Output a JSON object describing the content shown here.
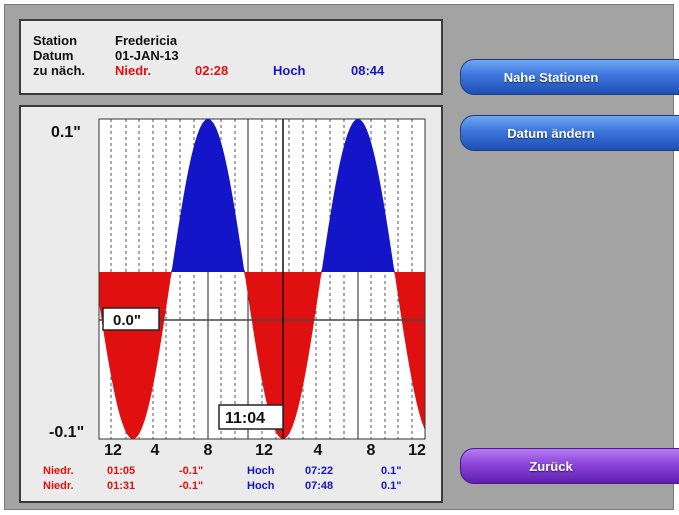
{
  "info": {
    "station_label": "Station",
    "station_value": "Fredericia",
    "datum_label": "Datum",
    "datum_value": "01-JAN-13",
    "next_label": "zu näch.",
    "next_low_label": "Niedr.",
    "next_low_time": "02:28",
    "next_high_label": "Hoch",
    "next_high_time": "08:44"
  },
  "buttons": {
    "nearby_stations": "Nahe Stationen",
    "change_date": "Datum ändern",
    "back": "Zurück"
  },
  "chart": {
    "y_max_label": "0.1\"",
    "y_min_label": "-0.1\"",
    "level_box": "0.0\"",
    "cursor_time": "11:04",
    "x_tick_labels": [
      "12",
      "4",
      "8",
      "12",
      "4",
      "8",
      "12"
    ]
  },
  "tide_table": [
    {
      "low_label": "Niedr.",
      "low_time": "01:05",
      "low_value": "-0.1\"",
      "high_label": "Hoch",
      "high_time": "07:22",
      "high_value": "0.1\""
    },
    {
      "low_label": "Niedr.",
      "low_time": "01:31",
      "low_value": "-0.1\"",
      "high_label": "Hoch",
      "high_time": "07:48",
      "high_value": "0.1\""
    }
  ],
  "colors": {
    "low": "#e01010",
    "high": "#1414c8",
    "button_blue": "#3c75dc",
    "button_purple": "#8a44d9",
    "background": "#a3a3a3"
  },
  "icons": {
    "time_suffix": "small-superscript-marker"
  }
}
